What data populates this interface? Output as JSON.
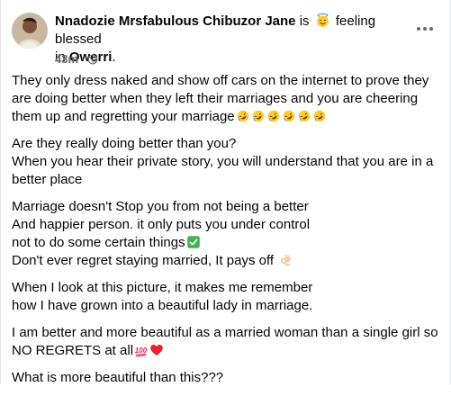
{
  "author": {
    "name": "Nnadozie Mrsfabulous Chibuzor Jane",
    "activity_prefix": "is",
    "feeling_icon": "smiling-face-with-halo-icon",
    "feeling": "feeling blessed",
    "location_prefix": "in",
    "location": "Owerri",
    "location_suffix": "."
  },
  "meta": {
    "time": "43m",
    "separator": "·",
    "privacy_icon": "globe-icon"
  },
  "more_icon": "more-options-icon",
  "post": {
    "paragraphs": [
      {
        "lines": [
          "They only dress naked and show off cars on the internet to prove they are doing better when they left their marriages and you are cheering them up and regretting your marriage"
        ],
        "emoji": [
          "rolling-on-floor-laughing-icon",
          "rolling-on-floor-laughing-icon",
          "rolling-on-floor-laughing-icon",
          "rolling-on-floor-laughing-icon",
          "rolling-on-floor-laughing-icon",
          "rolling-on-floor-laughing-icon"
        ]
      },
      {
        "lines": [
          "Are they really doing better than you?",
          "When you hear their private story, you will understand that you are in a better place"
        ]
      },
      {
        "lines": [
          "Marriage doesn't Stop you from not being a better",
          "And happier person. it only puts you under control",
          "not to do some certain things",
          "Don't ever regret staying married, It pays off"
        ],
        "line3_emoji": "check-mark-icon",
        "line4_emoji": "ok-hand-icon"
      },
      {
        "lines": [
          "When I look at this picture, it makes me remember",
          "how I have grown into a beautiful lady in marriage."
        ]
      },
      {
        "lines": [
          "I am better and more beautiful as a married woman than a single girl so NO REGRETS at all"
        ],
        "emoji": [
          "hundred-points-icon",
          "red-heart-icon"
        ]
      },
      {
        "lines": [
          "What is more beautiful than this???"
        ]
      }
    ]
  }
}
